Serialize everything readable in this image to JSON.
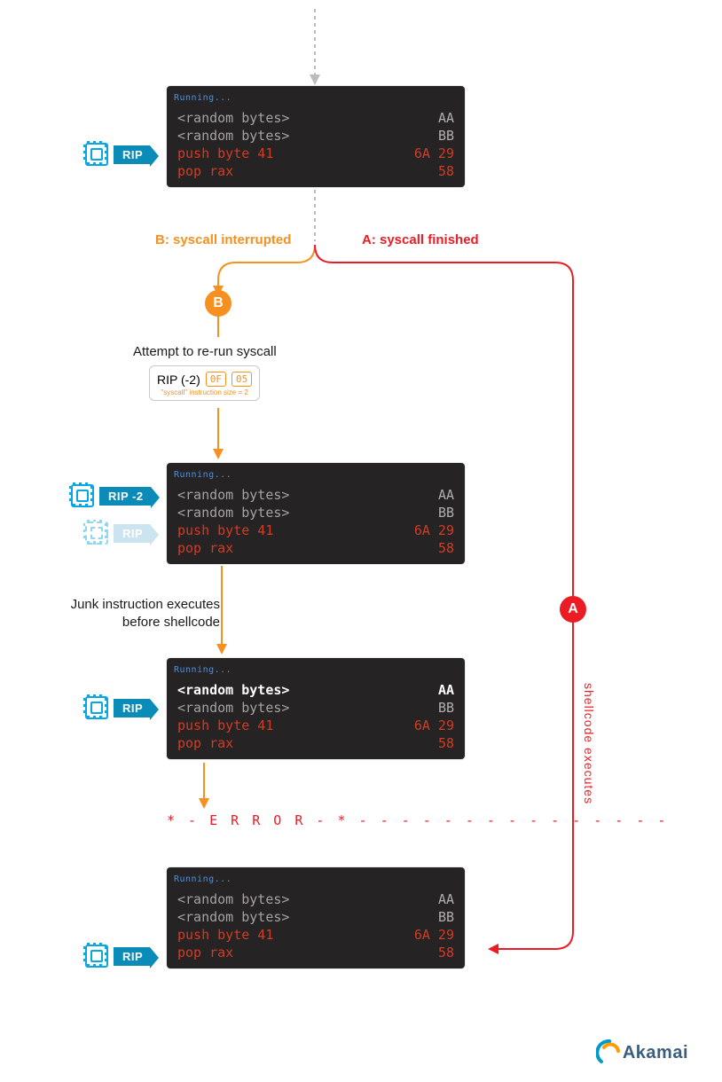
{
  "colors": {
    "terminal_bg": "#262324",
    "orange": "#f59021",
    "red": "#ec1c24",
    "blue": "#09a7df",
    "running": "#4a8fe3"
  },
  "chips": {
    "rip": "RIP",
    "rip_minus_2": "RIP -2"
  },
  "terminal": {
    "running": "Running...",
    "line1_text": "<random bytes>",
    "line1_hex": "AA",
    "line2_text": "<random bytes>",
    "line2_hex": "BB",
    "line3_text": "push byte 41",
    "line3_hex": "6A 29",
    "line4_text": "pop rax",
    "line4_hex": "58"
  },
  "branch": {
    "b_label": "B: syscall interrupted",
    "a_label": "A: syscall finished",
    "b_badge": "B",
    "a_badge": "A"
  },
  "rerun": {
    "title": "Attempt to re-run syscall",
    "chip": "RIP (-2)",
    "byte1": "0F",
    "byte2": "05",
    "sub": "\"syscall\" instruction size = 2"
  },
  "note": {
    "junk_line1": "Junk instruction executes",
    "junk_line2": "before shellcode"
  },
  "error": "* - E R R O R - * - - - - - - - - - - - - - - -",
  "path_a_note": "shellcode executes",
  "logo": {
    "name": "Akamai"
  }
}
